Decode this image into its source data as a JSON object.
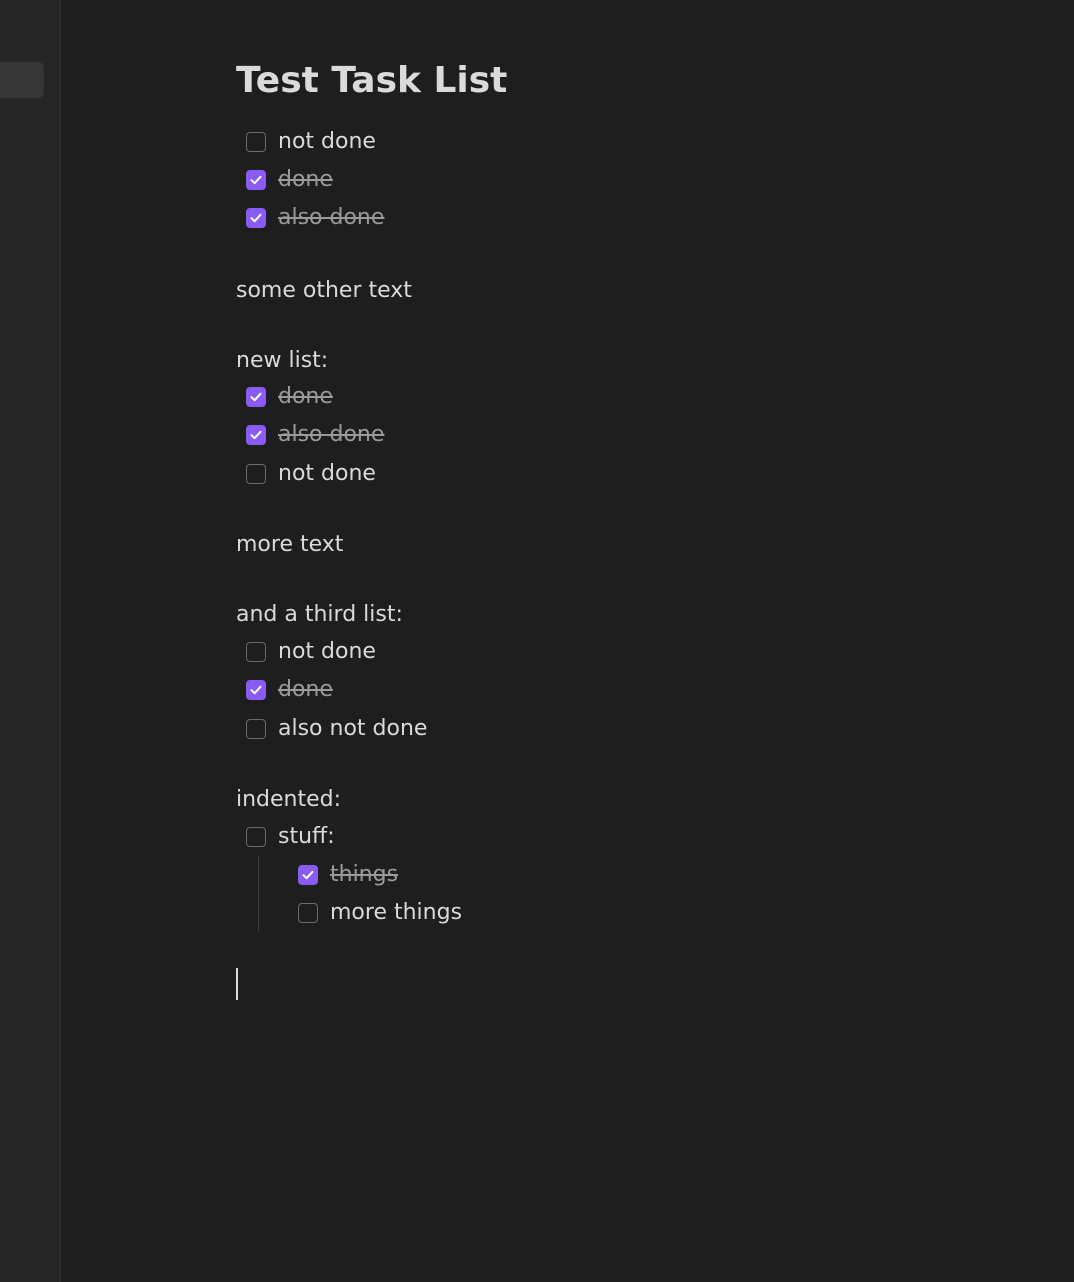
{
  "document": {
    "title": "Test Task List",
    "list1": [
      {
        "label": "not done",
        "done": false
      },
      {
        "label": "done",
        "done": true
      },
      {
        "label": "also done",
        "done": true
      }
    ],
    "text1": "some other text",
    "text2": "new list:",
    "list2": [
      {
        "label": "done",
        "done": true
      },
      {
        "label": "also done",
        "done": true
      },
      {
        "label": "not done",
        "done": false
      }
    ],
    "text3": "more text",
    "text4": "and a third list:",
    "list3": [
      {
        "label": "not done",
        "done": false
      },
      {
        "label": "done",
        "done": true
      },
      {
        "label": "also not done",
        "done": false
      }
    ],
    "text5": "indented:",
    "list4": [
      {
        "label": "stuff:",
        "done": false
      },
      {
        "label": "things",
        "done": true
      },
      {
        "label": "more things",
        "done": false
      }
    ]
  },
  "colors": {
    "background": "#1e1e1e",
    "sidebar": "#262626",
    "accent": "#8a5cf5",
    "text": "#dadada",
    "done_text": "#9a9a9a"
  }
}
